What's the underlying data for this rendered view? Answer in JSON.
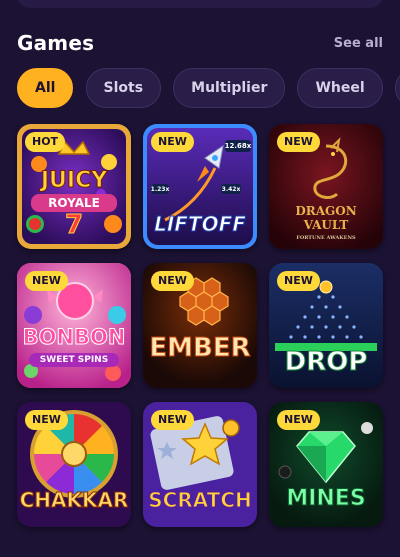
{
  "section": {
    "title": "Games",
    "see_all": "See all"
  },
  "filters": [
    {
      "label": "All",
      "active": true
    },
    {
      "label": "Slots",
      "active": false
    },
    {
      "label": "Multiplier",
      "active": false
    },
    {
      "label": "Wheel",
      "active": false
    },
    {
      "label": "",
      "active": false
    }
  ],
  "games": [
    {
      "badge": "HOT",
      "title": "JUICY",
      "subtitle": "ROYALE",
      "extra": "7",
      "icon": "fruit-slot-icon"
    },
    {
      "badge": "NEW",
      "title": "LIFTOFF",
      "multipliers": [
        "12.68x",
        "3.42x",
        "1.23x"
      ],
      "icon": "rocket-icon"
    },
    {
      "badge": "NEW",
      "title": "DRAGON",
      "subtitle": "VAULT",
      "tagline": "FORTUNE AWAKENS",
      "icon": "dragon-icon"
    },
    {
      "badge": "NEW",
      "title": "BONBON",
      "subtitle": "SWEET SPINS",
      "icon": "candy-icon"
    },
    {
      "badge": "NEW",
      "title": "EMBER",
      "icon": "hexagon-icon"
    },
    {
      "badge": "NEW",
      "title": "DROP",
      "icon": "plinko-icon"
    },
    {
      "badge": "NEW",
      "title": "CHAKKAR",
      "icon": "wheel-icon"
    },
    {
      "badge": "NEW",
      "title": "SCRATCH",
      "icon": "star-icon"
    },
    {
      "badge": "NEW",
      "title": "MINES",
      "icon": "gem-icon"
    }
  ]
}
